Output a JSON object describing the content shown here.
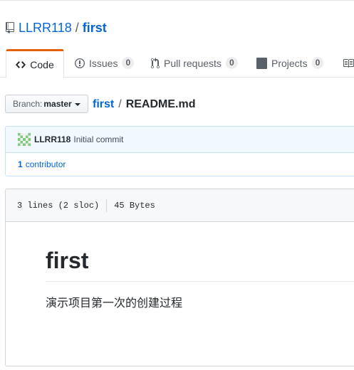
{
  "repo": {
    "owner": "LLRR118",
    "separator": "/",
    "name": "first"
  },
  "tabs": [
    {
      "label": "Code",
      "icon": "code-icon",
      "selected": true
    },
    {
      "label": "Issues",
      "icon": "issue-opened-icon",
      "count": "0"
    },
    {
      "label": "Pull requests",
      "icon": "git-pull-request-icon",
      "count": "0"
    },
    {
      "label": "Projects",
      "icon": "project-icon",
      "count": "0"
    }
  ],
  "branch": {
    "label": "Branch:",
    "value": "master"
  },
  "breadcrumb": {
    "repo": "first",
    "separator": "/",
    "file": "README.md"
  },
  "commit": {
    "author": "LLRR118",
    "message": "Initial commit"
  },
  "contributors": {
    "count": "1",
    "label": "contributor"
  },
  "file": {
    "lines": "3 lines (2 sloc)",
    "size": "45 Bytes"
  },
  "readme": {
    "heading": "first",
    "body": "演示项目第一次的创建过程"
  },
  "colors": {
    "link": "#0366d6",
    "tab_accent": "#e36209",
    "commit_bg": "#f1f8ff"
  }
}
